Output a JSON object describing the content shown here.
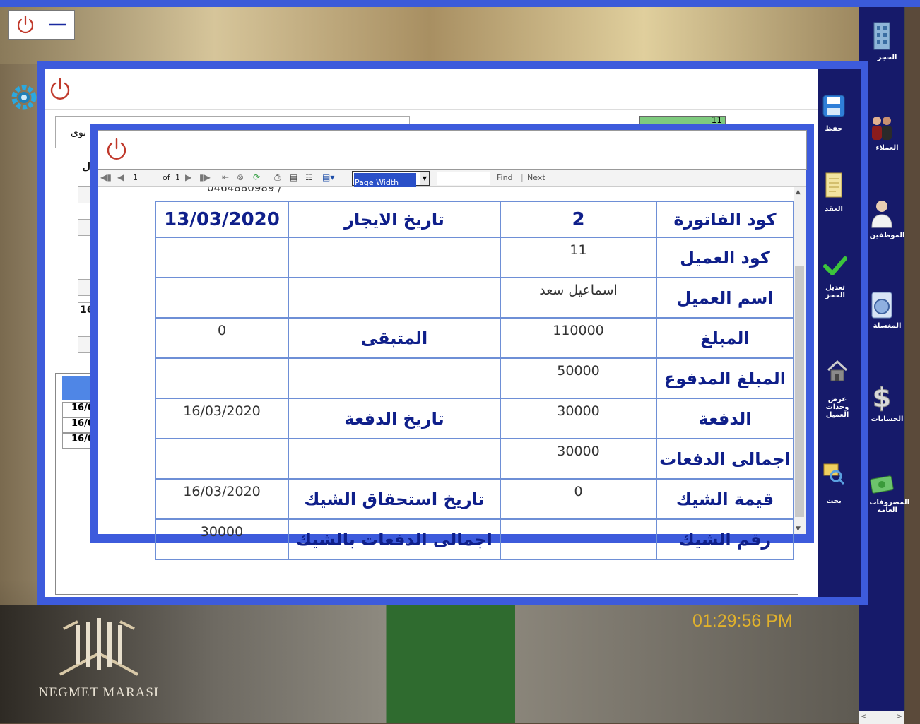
{
  "desktop": {
    "clock": "01:29:56 PM",
    "logo_text": "NEGMET MARASI"
  },
  "right_sidebar": [
    {
      "label": "الحجز",
      "icon": "building-icon"
    },
    {
      "label": "العملاء",
      "icon": "people-icon"
    },
    {
      "label": "الموظفين",
      "icon": "employee-icon"
    },
    {
      "label": "المغسلة",
      "icon": "washing-machine-icon"
    },
    {
      "label": "الحسابات",
      "icon": "dollar-icon"
    },
    {
      "label": "المصروفات العامة",
      "icon": "money-icon"
    }
  ],
  "main_toolbar": [
    {
      "label": "حفظ",
      "icon": "save-icon"
    },
    {
      "label": "العقد",
      "icon": "contract-icon"
    },
    {
      "label": "تعديل الحجز",
      "icon": "check-icon"
    },
    {
      "label": "عرض وحدات العميل",
      "icon": "house-icon"
    },
    {
      "label": "بحث",
      "icon": "search-icon"
    }
  ],
  "main_form": {
    "partial_text_1": "توى",
    "partial_text_2": "ل",
    "partial_value": "16",
    "partial_field_value": "11",
    "grid_rows": [
      "16/0",
      "16/0",
      "16/0"
    ]
  },
  "report_viewer": {
    "toolbar": {
      "page_current": "1",
      "page_of": "of",
      "page_total": "1",
      "zoom": "Page Width",
      "find": "Find",
      "next": "Next"
    },
    "partial_phone": "0464880989 /",
    "rows": [
      {
        "label": "كود الفاتورة",
        "value": "2",
        "label2": "تاريخ الايجار",
        "value2": "13/03/2020"
      },
      {
        "label": "كود العميل",
        "value": "11",
        "label2": "",
        "value2": ""
      },
      {
        "label": "اسم العميل",
        "value": "اسماعيل سعد",
        "label2": "",
        "value2": ""
      },
      {
        "label": "المبلغ",
        "value": "110000",
        "label2": "المتبقى",
        "value2": "0"
      },
      {
        "label": "المبلغ المدفوع",
        "value": "50000",
        "label2": "",
        "value2": ""
      },
      {
        "label": "الدفعة",
        "value": "30000",
        "label2": "تاريخ الدفعة",
        "value2": "16/03/2020"
      },
      {
        "label": "اجمالى الدفعات",
        "value": "30000",
        "label2": "",
        "value2": ""
      },
      {
        "label": "قيمة الشيك",
        "value": "0",
        "label2": "تاريخ استحقاق الشيك",
        "value2": "16/03/2020"
      },
      {
        "label": "رقم الشيك",
        "value": "",
        "label2": "اجمالى الدفعات بالشيك",
        "value2": "30000"
      }
    ]
  },
  "colors": {
    "frame_blue": "#3d5bdc",
    "sidebar_navy": "#161a6a",
    "label_blue": "#0f1f8a",
    "clock_gold": "#e0b12c",
    "power_red": "#c0392b"
  }
}
